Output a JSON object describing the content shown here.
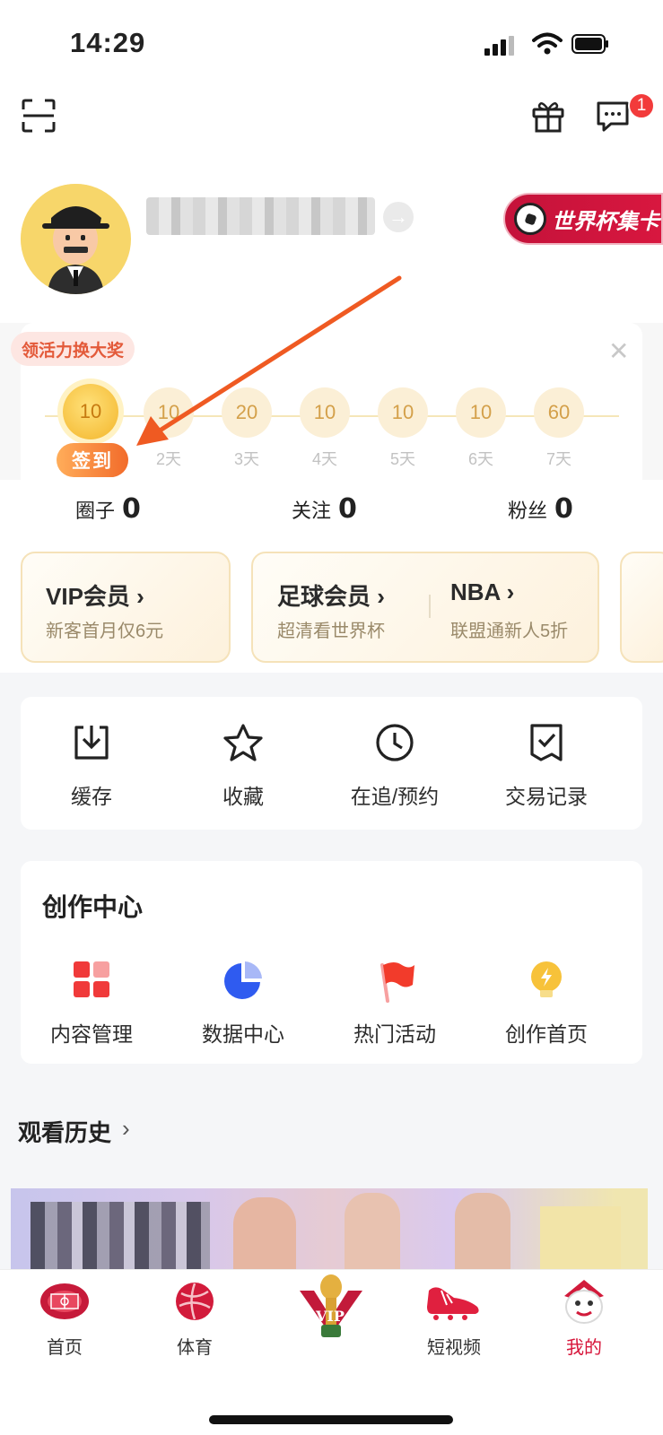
{
  "status_bar": {
    "time": "14:29"
  },
  "header": {
    "notification_count": "1"
  },
  "profile": {
    "badge_label": "世界杯集卡"
  },
  "checkin": {
    "promo_tag": "领活力换大奖",
    "sign_label": "签到",
    "days": [
      {
        "points": "10",
        "label": ""
      },
      {
        "points": "10",
        "label": "2天"
      },
      {
        "points": "20",
        "label": "3天"
      },
      {
        "points": "10",
        "label": "4天"
      },
      {
        "points": "10",
        "label": "5天"
      },
      {
        "points": "10",
        "label": "6天"
      },
      {
        "points": "60",
        "label": "7天"
      }
    ]
  },
  "stats": [
    {
      "label": "圈子",
      "value": "0"
    },
    {
      "label": "关注",
      "value": "0"
    },
    {
      "label": "粉丝",
      "value": "0"
    }
  ],
  "membership": {
    "vip": {
      "title": "VIP会员 ›",
      "sub": "新客首月仅6元"
    },
    "football": {
      "title": "足球会员 ›",
      "sub": "超清看世界杯"
    },
    "nba": {
      "title": "NBA ›",
      "sub": "联盟通新人5折"
    }
  },
  "quick_actions": [
    {
      "label": "缓存",
      "icon": "download-icon"
    },
    {
      "label": "收藏",
      "icon": "star-icon"
    },
    {
      "label": "在追/预约",
      "icon": "clock-icon"
    },
    {
      "label": "交易记录",
      "icon": "receipt-icon"
    }
  ],
  "creator": {
    "title": "创作中心",
    "items": [
      {
        "label": "内容管理",
        "icon": "grid-icon"
      },
      {
        "label": "数据中心",
        "icon": "pie-chart-icon"
      },
      {
        "label": "热门活动",
        "icon": "flag-icon"
      },
      {
        "label": "创作首页",
        "icon": "bulb-icon"
      }
    ]
  },
  "history": {
    "title": "观看历史",
    "arrow": "›"
  },
  "tabbar": [
    {
      "label": "首页",
      "icon": "stadium-icon"
    },
    {
      "label": "体育",
      "icon": "sports-ball-icon"
    },
    {
      "label": "",
      "icon": "vip-trophy-icon"
    },
    {
      "label": "短视频",
      "icon": "football-boot-icon"
    },
    {
      "label": "我的",
      "icon": "mascot-icon"
    }
  ],
  "colors": {
    "brand_red": "#d7153a",
    "checkin_orange": "#f26b2a",
    "annotation_arrow": "#ef5a22"
  }
}
